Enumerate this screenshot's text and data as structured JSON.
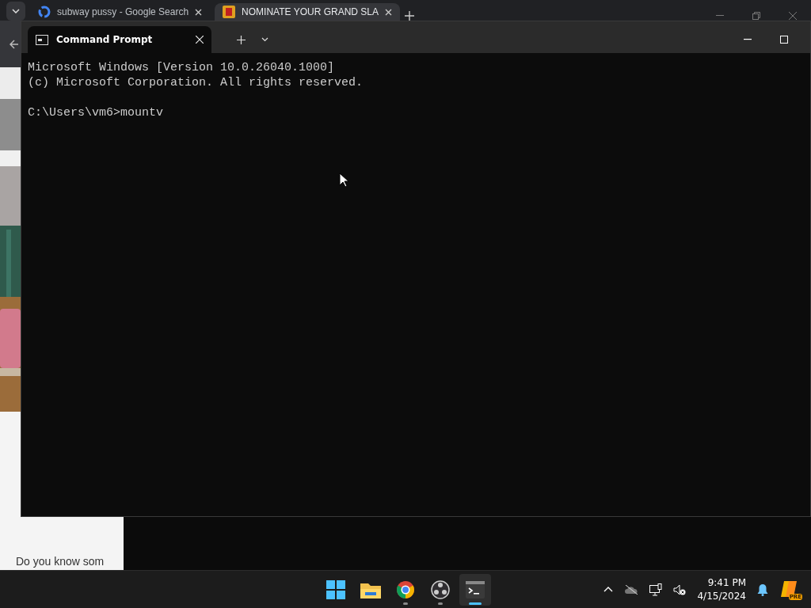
{
  "browser": {
    "tabs": [
      {
        "title": "subway pussy - Google Search",
        "selected": false
      },
      {
        "title": "NOMINATE YOUR GRAND SLA",
        "selected": true
      }
    ],
    "page": {
      "paragraph": "Do you know som"
    }
  },
  "terminal": {
    "tabs": [
      {
        "title": "Command Prompt",
        "selected": true
      }
    ],
    "blocks": [
      [
        "Microsoft Windows [Version 10.0.26040.1000]",
        "(c) Microsoft Corporation. All rights reserved."
      ],
      [
        "C:\\Users\\vm6>mountv"
      ]
    ]
  },
  "taskbar": {
    "apps": [
      {
        "kind": "start",
        "running": false,
        "active": false
      },
      {
        "kind": "folder",
        "running": false,
        "active": false
      },
      {
        "kind": "chrome",
        "running": true,
        "active": false
      },
      {
        "kind": "obs",
        "running": true,
        "active": false
      },
      {
        "kind": "terminal",
        "running": true,
        "active": true
      }
    ],
    "time": "9:41 PM",
    "date": "4/15/2024",
    "badge": "PRE"
  }
}
